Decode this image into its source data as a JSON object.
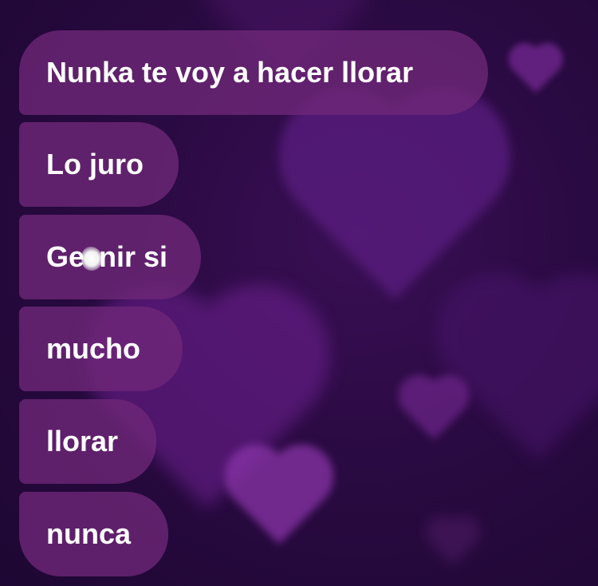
{
  "messages": [
    {
      "text": "Nunka te voy a hacer llorar"
    },
    {
      "text": "Lo juro"
    },
    {
      "text_before": "Ge",
      "text_after": "nir si"
    },
    {
      "text": "mucho"
    },
    {
      "text": "llorar"
    },
    {
      "text": "nunca"
    }
  ],
  "colors": {
    "background": "#2a0a42",
    "bubble": "#702878",
    "text": "#ffffff",
    "hearts": "#6a1a8a"
  }
}
